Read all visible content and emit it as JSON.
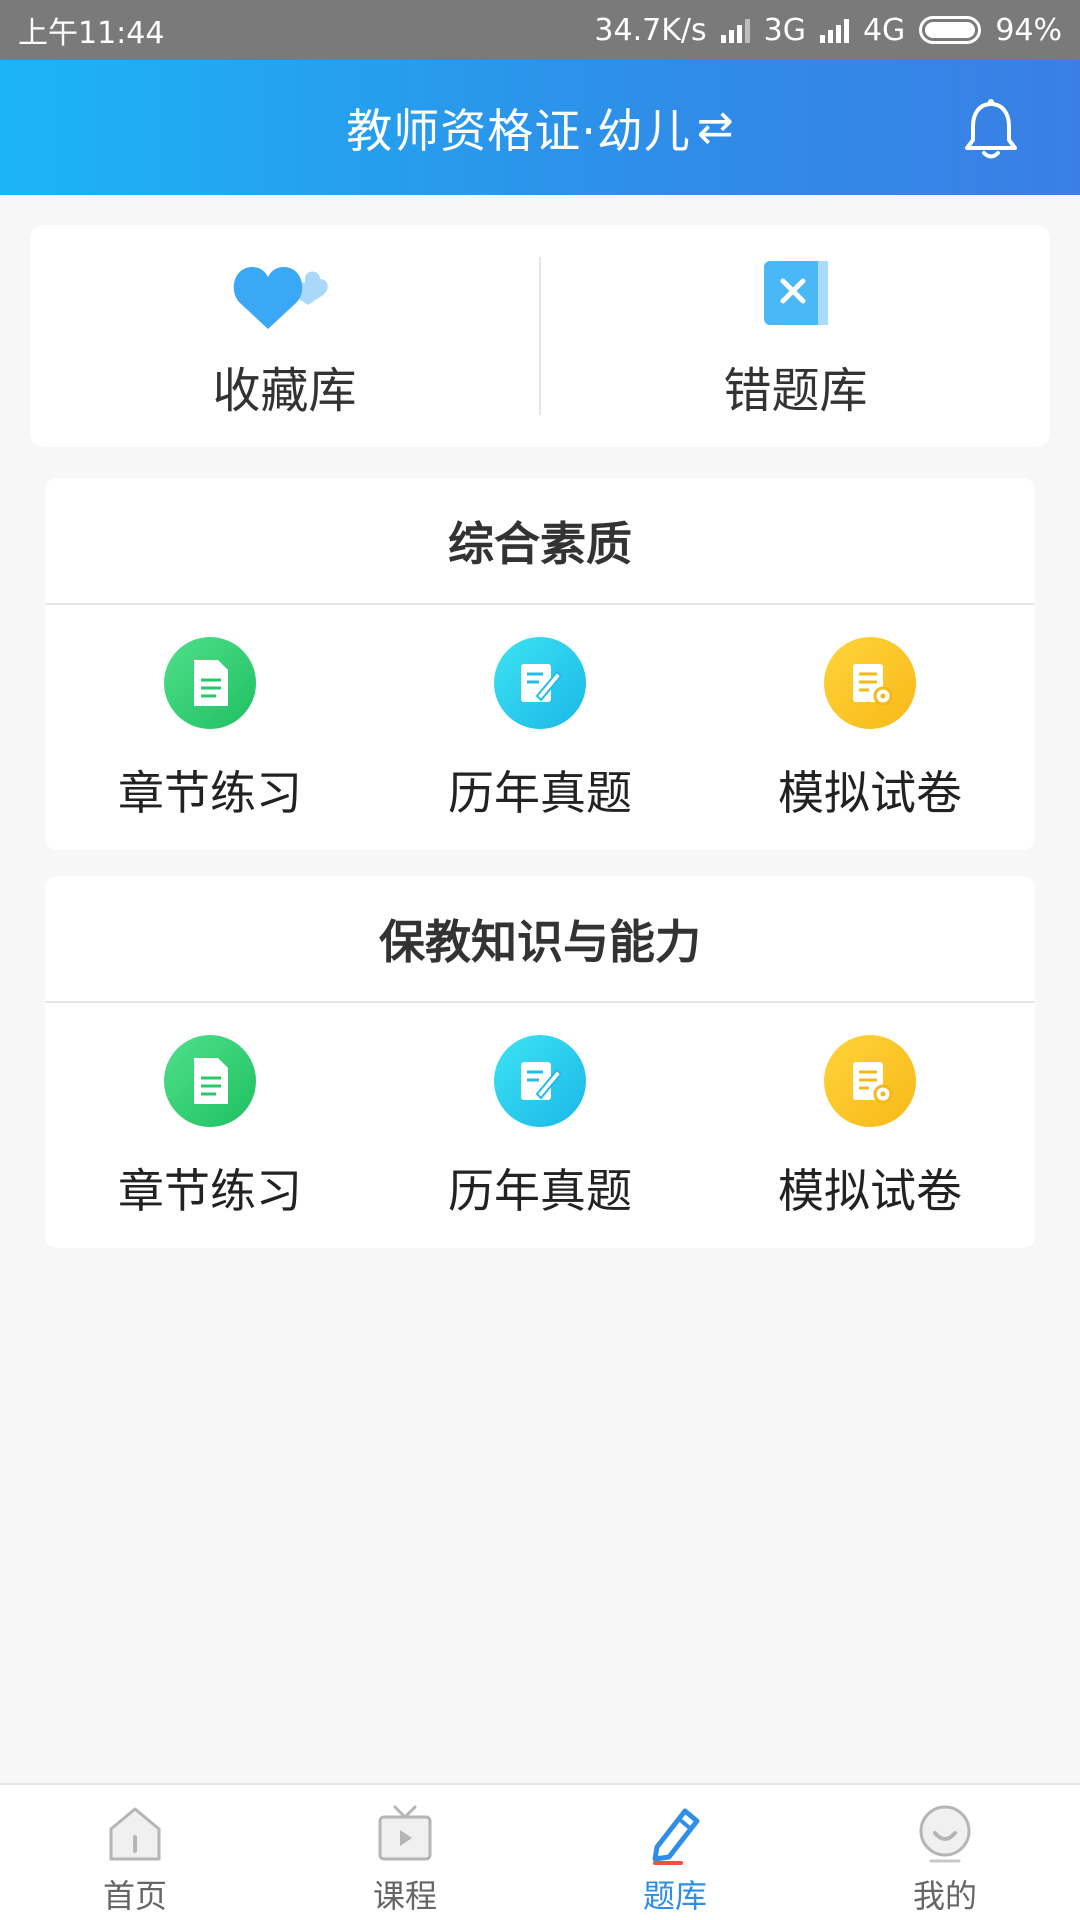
{
  "status_bar": {
    "time": "上午11:44",
    "speed": "34.7K/s",
    "net1": "3G",
    "net2": "4G",
    "battery": "94%"
  },
  "header": {
    "title": "教师资格证·幼儿",
    "swap_glyph": "⇄"
  },
  "top_card": {
    "favorites_label": "收藏库",
    "wrong_label": "错题库"
  },
  "sections": [
    {
      "title": "综合素质",
      "items": [
        "章节练习",
        "历年真题",
        "模拟试卷"
      ]
    },
    {
      "title": "保教知识与能力",
      "items": [
        "章节练习",
        "历年真题",
        "模拟试卷"
      ]
    }
  ],
  "bottom_nav": {
    "items": [
      {
        "label": "首页",
        "icon": "home-icon"
      },
      {
        "label": "课程",
        "icon": "tv-icon"
      },
      {
        "label": "题库",
        "icon": "pencil-icon"
      },
      {
        "label": "我的",
        "icon": "profile-icon"
      }
    ],
    "active_index": 2
  },
  "colors": {
    "header_start": "#1cb4f6",
    "header_end": "#3a7fe6",
    "active_tab": "#2f8fe8",
    "chapter_green": "#1fbf61",
    "past_cyan": "#1ab8e8",
    "mock_gold": "#f8b818"
  }
}
